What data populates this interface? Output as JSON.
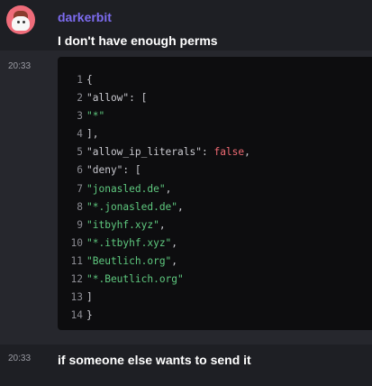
{
  "message1": {
    "avatar": "avatar-icon",
    "username": "darkerbit",
    "username_color": "#7d6cf0",
    "text": "I don't have enough perms"
  },
  "code_message": {
    "timestamp": "20:33",
    "lines": [
      {
        "num": "1",
        "parts": [
          {
            "t": "{",
            "c": "punc"
          }
        ]
      },
      {
        "num": "2",
        "parts": [
          {
            "t": "\"allow\": [",
            "c": "punc"
          }
        ]
      },
      {
        "num": "3",
        "parts": [
          {
            "t": "\"*\"",
            "c": "str"
          }
        ]
      },
      {
        "num": "4",
        "parts": [
          {
            "t": "],",
            "c": "punc"
          }
        ]
      },
      {
        "num": "5",
        "parts": [
          {
            "t": "\"allow_ip_literals\": ",
            "c": "punc"
          },
          {
            "t": "false",
            "c": "kw"
          },
          {
            "t": ",",
            "c": "punc"
          }
        ]
      },
      {
        "num": "6",
        "parts": [
          {
            "t": "\"deny\": [",
            "c": "punc"
          }
        ]
      },
      {
        "num": "7",
        "parts": [
          {
            "t": "\"jonasled.de\"",
            "c": "str"
          },
          {
            "t": ",",
            "c": "punc"
          }
        ]
      },
      {
        "num": "8",
        "parts": [
          {
            "t": "\"*.jonasled.de\"",
            "c": "str"
          },
          {
            "t": ",",
            "c": "punc"
          }
        ]
      },
      {
        "num": "9",
        "parts": [
          {
            "t": "\"itbyhf.xyz\"",
            "c": "str"
          },
          {
            "t": ",",
            "c": "punc"
          }
        ]
      },
      {
        "num": "10",
        "parts": [
          {
            "t": "\"*.itbyhf.xyz\"",
            "c": "str"
          },
          {
            "t": ",",
            "c": "punc"
          }
        ]
      },
      {
        "num": "11",
        "parts": [
          {
            "t": "\"Beutlich.org\"",
            "c": "str"
          },
          {
            "t": ",",
            "c": "punc"
          }
        ]
      },
      {
        "num": "12",
        "parts": [
          {
            "t": "\"*.Beutlich.org\"",
            "c": "str"
          }
        ]
      },
      {
        "num": "13",
        "parts": [
          {
            "t": "]",
            "c": "punc"
          }
        ]
      },
      {
        "num": "14",
        "parts": [
          {
            "t": "}",
            "c": "punc"
          }
        ]
      }
    ]
  },
  "message2": {
    "timestamp": "20:33",
    "text": "if someone else wants to send it"
  },
  "colors": {
    "background": "#1e1f24",
    "highlight_row": "#26272d",
    "code_background": "#0d0d0f",
    "string": "#5fc97f",
    "keyword": "#ef6a73"
  }
}
